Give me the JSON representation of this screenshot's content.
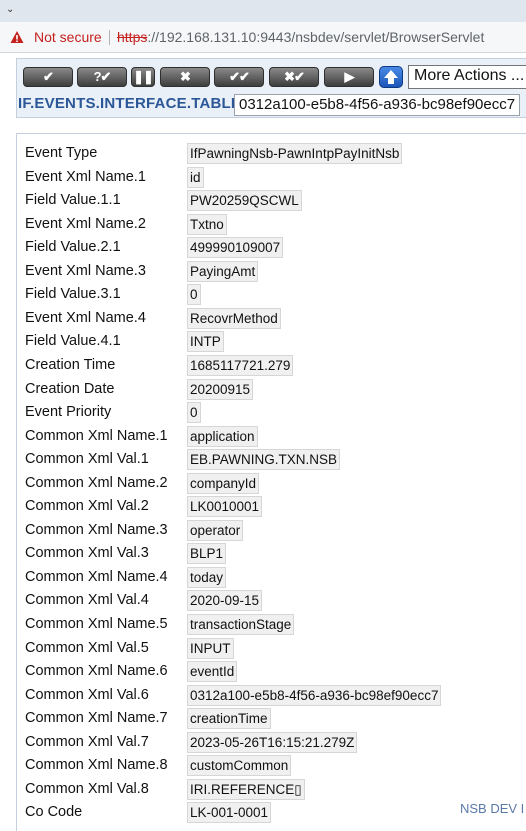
{
  "browser": {
    "security_label": "Not secure",
    "url_scheme": "https",
    "url_rest": "://192.168.131.10:9443/nsbdev/servlet/BrowserServlet"
  },
  "toolbar": {
    "buttons": [
      {
        "name": "commit-button",
        "glyph": "✔"
      },
      {
        "name": "validate-button",
        "glyph": "?✔"
      },
      {
        "name": "hold-button",
        "glyph": "❚❚"
      },
      {
        "name": "delete-button",
        "glyph": "✖"
      },
      {
        "name": "authorise-button",
        "glyph": "✔✔"
      },
      {
        "name": "reverse-button",
        "glyph": "✖✔"
      },
      {
        "name": "next-button",
        "glyph": "▶"
      }
    ],
    "more_actions": "More Actions ...",
    "application": "IF.EVENTS.INTERFACE.TABLE",
    "record_id": "0312a100-e5b8-4f56-a936-bc98ef90ecc7"
  },
  "fields": [
    {
      "label": "Event Type",
      "value": "IfPawningNsb-PawnIntpPayInitNsb"
    },
    {
      "label": "Event Xml Name.1",
      "value": "id"
    },
    {
      "label": "Field Value.1.1",
      "value": "PW20259QSCWL"
    },
    {
      "label": "Event Xml Name.2",
      "value": "Txtno"
    },
    {
      "label": "Field Value.2.1",
      "value": "499990109007"
    },
    {
      "label": "Event Xml Name.3",
      "value": "PayingAmt"
    },
    {
      "label": "Field Value.3.1",
      "value": "0"
    },
    {
      "label": "Event Xml Name.4",
      "value": "RecovrMethod"
    },
    {
      "label": "Field Value.4.1",
      "value": "INTP"
    },
    {
      "label": "Creation Time",
      "value": "1685117721.279"
    },
    {
      "label": "Creation Date",
      "value": "20200915"
    },
    {
      "label": "Event Priority",
      "value": "0"
    },
    {
      "label": "Common Xml Name.1",
      "value": "application"
    },
    {
      "label": "Common Xml Val.1",
      "value": "EB.PAWNING.TXN.NSB"
    },
    {
      "label": "Common Xml Name.2",
      "value": "companyId"
    },
    {
      "label": "Common Xml Val.2",
      "value": "LK0010001"
    },
    {
      "label": "Common Xml Name.3",
      "value": "operator"
    },
    {
      "label": "Common Xml Val.3",
      "value": "BLP1"
    },
    {
      "label": "Common Xml Name.4",
      "value": "today"
    },
    {
      "label": "Common Xml Val.4",
      "value": "2020-09-15"
    },
    {
      "label": "Common Xml Name.5",
      "value": "transactionStage"
    },
    {
      "label": "Common Xml Val.5",
      "value": "INPUT"
    },
    {
      "label": "Common Xml Name.6",
      "value": "eventId"
    },
    {
      "label": "Common Xml Val.6",
      "value": "0312a100-e5b8-4f56-a936-bc98ef90ecc7"
    },
    {
      "label": "Common Xml Name.7",
      "value": "creationTime"
    },
    {
      "label": "Common Xml Val.7",
      "value": "2023-05-26T16:15:21.279Z"
    },
    {
      "label": "Common Xml Name.8",
      "value": "customCommon"
    },
    {
      "label": "Common Xml Val.8",
      "value": "IRI.REFERENCE▯"
    },
    {
      "label": "Co Code",
      "value": "LK-001-0001"
    }
  ],
  "footer": {
    "environment": "NSB DEV I"
  }
}
